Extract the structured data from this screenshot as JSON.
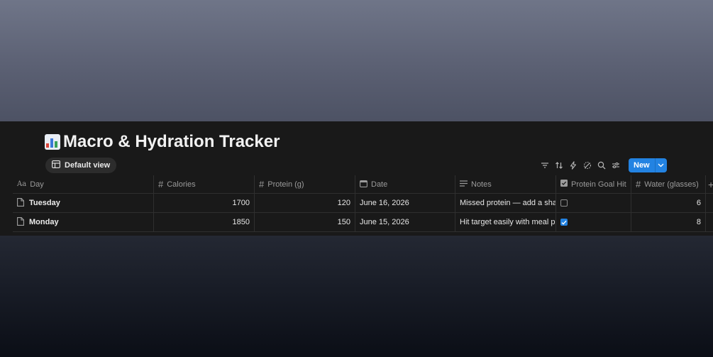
{
  "page": {
    "title": "Macro & Hydration Tracker",
    "title_icon": "bar-chart-emoji"
  },
  "view": {
    "label": "Default view",
    "icon": "table-icon"
  },
  "toolbar": {
    "icons": [
      "filter-icon",
      "sort-icon",
      "automation-icon",
      "ai-icon",
      "search-icon",
      "settings-icon"
    ],
    "new_label": "New"
  },
  "table": {
    "columns": [
      {
        "label": "Day",
        "icon": "title-icon"
      },
      {
        "label": "Calories",
        "icon": "number-icon"
      },
      {
        "label": "Protein (g)",
        "icon": "number-icon"
      },
      {
        "label": "Date",
        "icon": "calendar-icon"
      },
      {
        "label": "Notes",
        "icon": "text-icon"
      },
      {
        "label": "Protein Goal Hit",
        "icon": "checkbox-icon"
      },
      {
        "label": "Water (glasses)",
        "icon": "number-icon"
      }
    ],
    "rows": [
      {
        "day": "Tuesday",
        "calories": "1700",
        "protein": "120",
        "date": "June 16, 2026",
        "notes": "Missed protein — add a shake",
        "goal_hit": false,
        "water": "6"
      },
      {
        "day": "Monday",
        "calories": "1850",
        "protein": "150",
        "date": "June 15, 2026",
        "notes": "Hit target easily with meal prep",
        "goal_hit": true,
        "water": "8"
      }
    ]
  },
  "colors": {
    "accent": "#2383e2",
    "panel": "#191919",
    "border": "#2f2f2f"
  }
}
